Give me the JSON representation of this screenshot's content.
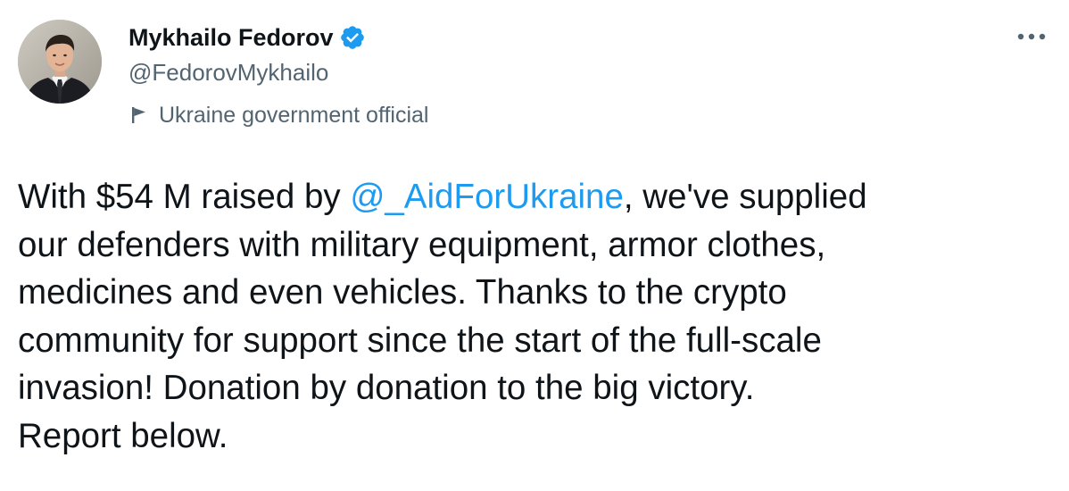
{
  "author": {
    "display_name": "Mykhailo Fedorov",
    "handle": "@FedorovMykhailo",
    "label": "Ukraine government official",
    "verified_icon": "verified-badge-icon",
    "label_icon": "flag-icon"
  },
  "menu": {
    "icon": "more-horizontal-icon"
  },
  "tweet": {
    "line1_pre": "With $54 M raised by ",
    "mention": "@_AidForUkraine",
    "line1_post": ", we've supplied",
    "line2": "our defenders with military equipment, armor clothes,",
    "line3": "medicines and even vehicles. Thanks to the crypto",
    "line4": "community for support since the start of the full-scale",
    "line5": "invasion! Donation by donation to the big victory.",
    "line6": "Report below."
  },
  "colors": {
    "link": "#1d9bf0",
    "secondary_text": "#536471",
    "primary_text": "#0f1419",
    "verified": "#1d9bf0"
  }
}
